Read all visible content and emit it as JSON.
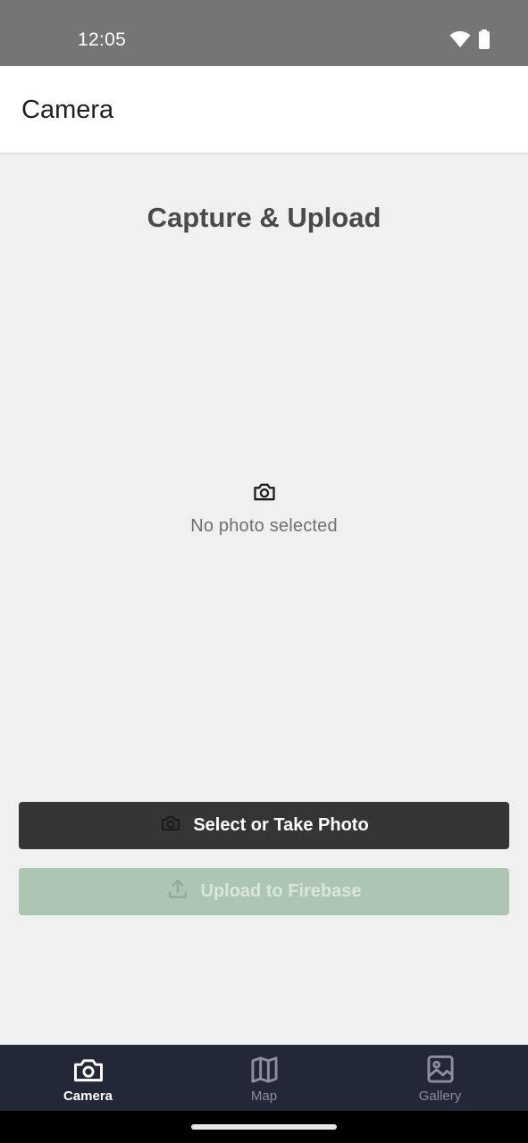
{
  "status_bar": {
    "time": "12:05",
    "icons": [
      "wifi-icon",
      "battery-icon"
    ]
  },
  "app_bar": {
    "title": "Camera"
  },
  "main": {
    "heading": "Capture & Upload",
    "placeholder": {
      "icon": "camera-icon",
      "text": "No photo selected"
    },
    "select_button": {
      "label": "Select or Take Photo",
      "icon": "camera-icon",
      "enabled": true
    },
    "upload_button": {
      "label": "Upload to Firebase",
      "icon": "upload-icon",
      "enabled": false
    }
  },
  "bottom_nav": {
    "items": [
      {
        "label": "Camera",
        "icon": "camera-icon",
        "active": true
      },
      {
        "label": "Map",
        "icon": "map-icon",
        "active": false
      },
      {
        "label": "Gallery",
        "icon": "gallery-icon",
        "active": false
      }
    ]
  },
  "colors": {
    "status_bar": "#757575",
    "select_button": "#353535",
    "upload_button_disabled": "#adc6b4",
    "bottom_nav": "#222835"
  }
}
